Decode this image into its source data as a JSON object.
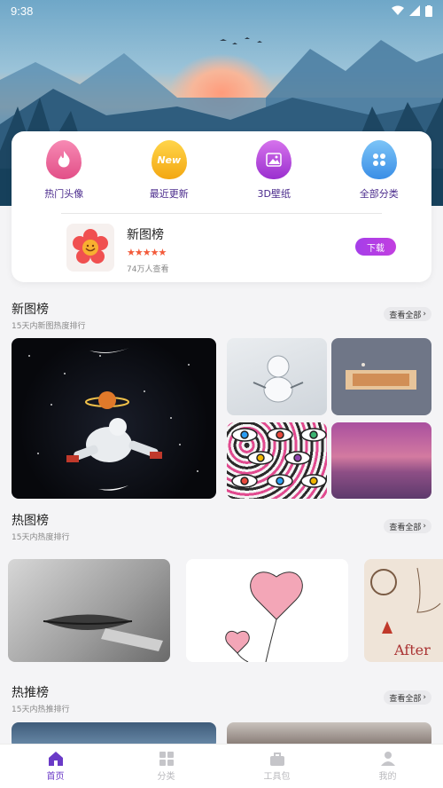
{
  "status": {
    "time": "9:38"
  },
  "quick_links": [
    {
      "label": "热门头像",
      "icon": "flame-icon",
      "color": "#ec5a92"
    },
    {
      "label": "最近更新",
      "icon": "new-icon",
      "badge": "New",
      "color": "#f6b820"
    },
    {
      "label": "3D壁纸",
      "icon": "image-icon",
      "color": "#b24ad8"
    },
    {
      "label": "全部分类",
      "icon": "grid-icon",
      "color": "#4aa0ec"
    }
  ],
  "featured_app": {
    "name": "新图榜",
    "stars": "★★★★★",
    "subtitle": "74万人查看",
    "button": "下载"
  },
  "sections": {
    "new": {
      "title": "新图榜",
      "subtitle": "15天内新图热度排行",
      "see_all": "查看全部"
    },
    "hot": {
      "title": "热图榜",
      "subtitle": "15天内热度排行",
      "see_all": "查看全部"
    },
    "recommend": {
      "title": "热推榜",
      "subtitle": "15天内热推排行",
      "see_all": "查看全部"
    }
  },
  "nav": [
    {
      "label": "首页",
      "icon": "home-icon",
      "active": true
    },
    {
      "label": "分类",
      "icon": "grid-icon",
      "active": false
    },
    {
      "label": "工具包",
      "icon": "toolbox-icon",
      "active": false
    },
    {
      "label": "我的",
      "icon": "user-icon",
      "active": false
    }
  ],
  "colors": {
    "accent": "#6a3ac7",
    "button": "#b23fe6",
    "star": "#f35a3a"
  }
}
